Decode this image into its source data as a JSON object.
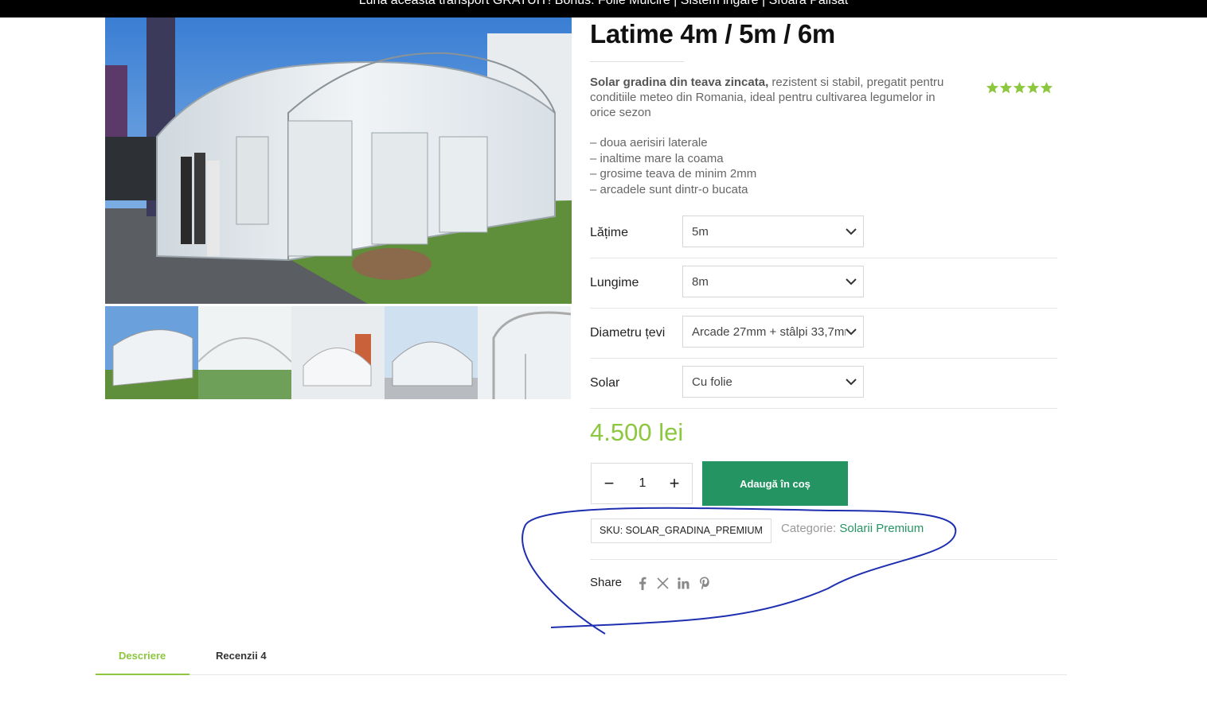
{
  "announcement": {
    "text": "Luna aceasta transport GRATUIT! Bonus: Folie Mulcire | Sistem irigare | Sfoara Palisat"
  },
  "gallery": {
    "thumbnails": [
      "solar-photo-1",
      "solar-photo-2",
      "solar-photo-3",
      "solar-photo-4",
      "solar-photo-5"
    ]
  },
  "product": {
    "title": "Latime 4m / 5m / 6m",
    "description_bold": "Solar gradina din teava zincata,",
    "description_rest": " rezistent si stabil, pregatit pentru conditiile meteo din Romania, ideal pentru cultivarea legumelor in orice sezon",
    "features": [
      "– doua aerisiri laterale",
      "– inaltime mare la coama",
      "– grosime teava de minim 2mm",
      "– arcadele sunt dintr-o bucata"
    ],
    "rating": 5,
    "rating_max": 5,
    "star_color": "#8dc63f",
    "variations": [
      {
        "label": "Lățime",
        "value": "5m"
      },
      {
        "label": "Lungime",
        "value": "8m"
      },
      {
        "label": "Diametru țevi",
        "value": "Arcade 27mm + stâlpi 33,7mm"
      },
      {
        "label": "Solar",
        "value": "Cu folie"
      }
    ],
    "price": "4.500 lei",
    "price_color": "#8dc63f",
    "quantity": "1",
    "minus_label": "−",
    "plus_label": "+",
    "add_to_cart": "Adaugă în coș",
    "button_color": "#259463",
    "sku_text": "SKU: SOLAR_GRADINA_PREMIUM",
    "category_label": "Categorie: ",
    "category_link": "Solarii Premium",
    "share_label": "Share",
    "share_icons": [
      "facebook-icon",
      "x-icon",
      "linkedin-icon",
      "pinterest-icon"
    ]
  },
  "tabs": [
    {
      "label": "Descriere",
      "active": true
    },
    {
      "label": "Recenzii 4",
      "active": false
    }
  ]
}
